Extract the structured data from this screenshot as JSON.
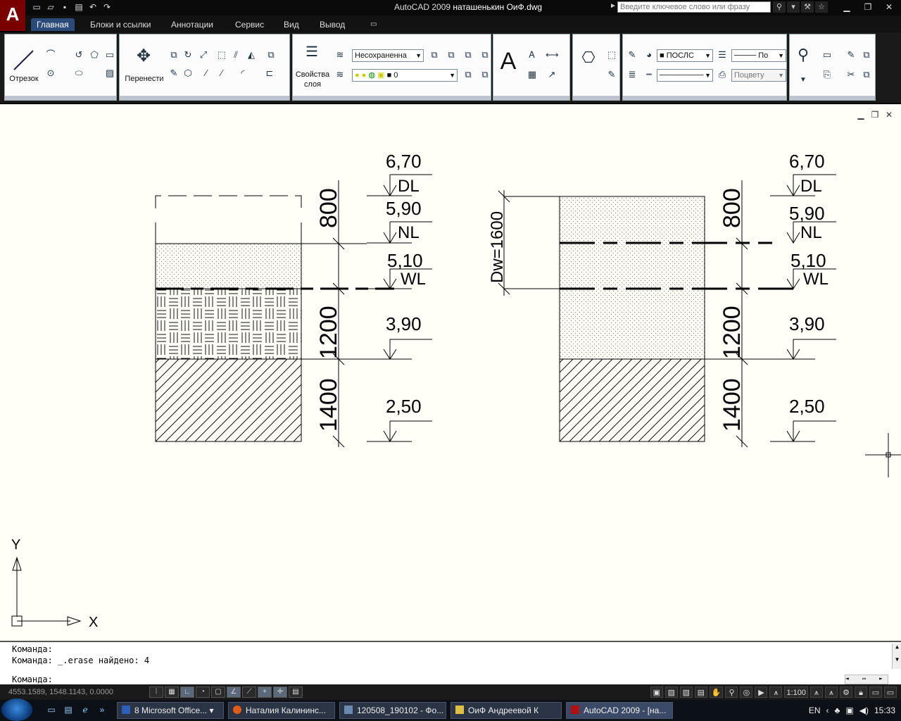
{
  "window": {
    "app_logo": "A",
    "title_app": "AutoCAD 2009",
    "title_file": "наташенькин ОиФ.dwg",
    "search_placeholder": "Введите ключевое слово или фразу"
  },
  "ribbon_tabs": [
    {
      "label": "Главная",
      "active": true
    },
    {
      "label": "Блоки и ссылки"
    },
    {
      "label": "Аннотации"
    },
    {
      "label": "Сервис"
    },
    {
      "label": "Вид"
    },
    {
      "label": "Вывод"
    }
  ],
  "ribbon": {
    "line_label": "Отрезок",
    "move_label": "Перенести",
    "layer_props_label": "Свойства\nслоя",
    "layer_state": "Несохраненна",
    "layer_current": "0",
    "color_combo": "ПОСЛС",
    "linetype_combo": "По",
    "plotstyle_combo": "Поцвету"
  },
  "drawing": {
    "left": {
      "elevations": [
        "6,70",
        "5,90",
        "5,10",
        "3,90",
        "2,50"
      ],
      "level_labels": [
        "DL",
        "NL",
        "WL"
      ],
      "dims": [
        "800",
        "1200",
        "1400"
      ]
    },
    "right": {
      "elevations": [
        "6,70",
        "5,90",
        "5,10",
        "3,90",
        "2,50"
      ],
      "level_labels": [
        "DL",
        "NL",
        "WL"
      ],
      "dims": [
        "800",
        "1200",
        "1400"
      ],
      "dw_label": "Dw=1600"
    },
    "ucs_x": "X",
    "ucs_y": "Y"
  },
  "command": {
    "line1": "Команда:",
    "line2": "Команда: _.erase найдено: 4",
    "prompt": "Команда:"
  },
  "status": {
    "coords": "4553.1589, 1548.1143, 0.0000",
    "scale": "1:100"
  },
  "taskbar": {
    "items": [
      {
        "label": "8 Microsoft Office..."
      },
      {
        "label": "Наталия Калининс..."
      },
      {
        "label": "120508_190102 - Фо..."
      },
      {
        "label": "ОиФ Андреевой К"
      },
      {
        "label": "AutoCAD 2009 - [на..."
      }
    ],
    "lang": "EN",
    "clock": "15:33"
  },
  "colors": {
    "canvas": "#fffff8",
    "ribbon_panel": "#fcfcfc",
    "taskbar": "#0c1118",
    "active_tab": "#2a4a7a"
  }
}
